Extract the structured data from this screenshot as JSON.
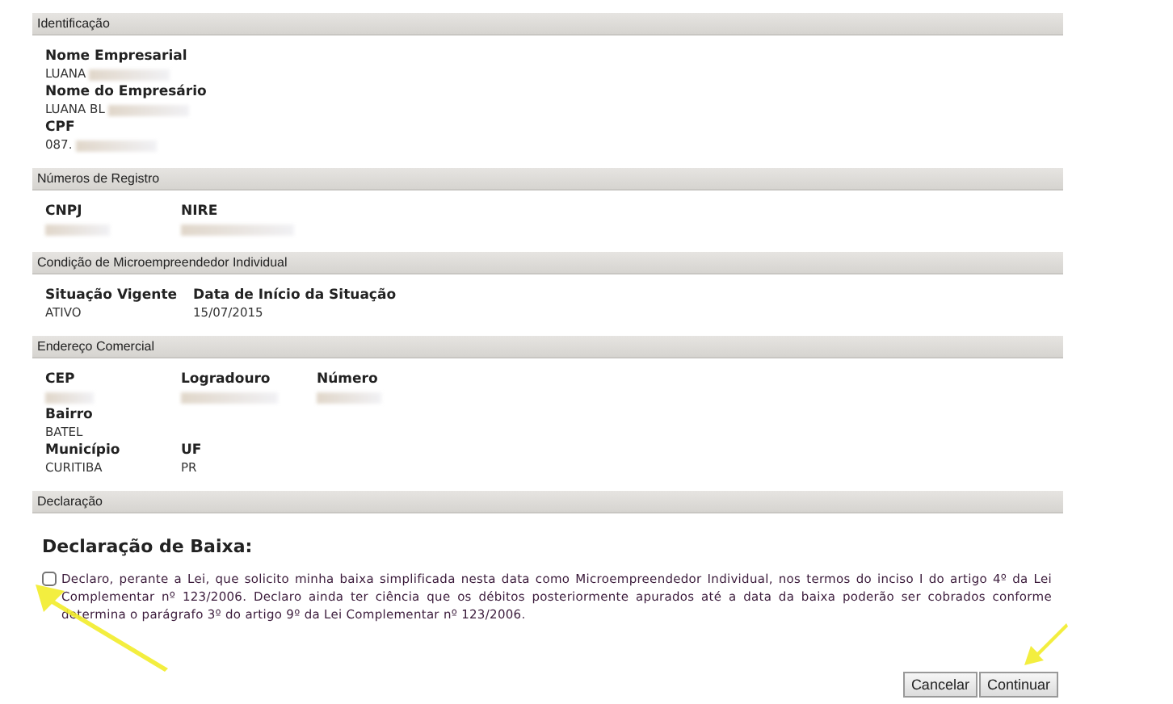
{
  "sections": [
    {
      "title": "Identificação",
      "rows": [
        [
          {
            "label": "Nome Empresarial",
            "value": "LUANA",
            "redacted": true
          }
        ],
        [
          {
            "label": "Nome do Empresário",
            "value": "LUANA BL",
            "redacted": true
          }
        ],
        [
          {
            "label": "CPF",
            "value": "087.",
            "redacted": true
          }
        ]
      ]
    },
    {
      "title": "Números de Registro",
      "rows": [
        [
          {
            "label": "CNPJ",
            "redacted": true
          },
          {
            "label": "NIRE",
            "redacted": true
          }
        ]
      ]
    },
    {
      "title": "Condição de Microempreendedor Individual",
      "rows": [
        [
          {
            "label": "Situação Vigente",
            "value": "ATIVO"
          },
          {
            "label": "Data de Início da Situação",
            "value": "15/07/2015"
          }
        ]
      ]
    },
    {
      "title": "Endereço Comercial",
      "rows": [
        [
          {
            "label": "CEP",
            "redacted": true
          },
          {
            "label": "Logradouro",
            "redacted": true
          },
          {
            "label": "Número",
            "redacted": true
          }
        ],
        [
          {
            "label": "Bairro",
            "value": "BATEL"
          }
        ],
        [
          {
            "label": "Município",
            "value": "CURITIBA"
          },
          {
            "label": "UF",
            "value": "PR"
          }
        ]
      ]
    },
    {
      "title": "Declaração"
    }
  ],
  "declaration": {
    "title": "Declaração de Baixa:",
    "checked": false,
    "text": "Declaro, perante a Lei, que solicito minha baixa simplificada nesta data como Microempreendedor Individual, nos termos do inciso I do artigo 4º da Lei Complementar nº 123/2006. Declaro ainda ter ciência que os débitos posteriormente apurados até a data da baixa poderão ser cobrados conforme determina o parágrafo 3º do artigo 9º da Lei Complementar nº 123/2006."
  },
  "buttons": [
    "Cancelar",
    "Continuar"
  ]
}
